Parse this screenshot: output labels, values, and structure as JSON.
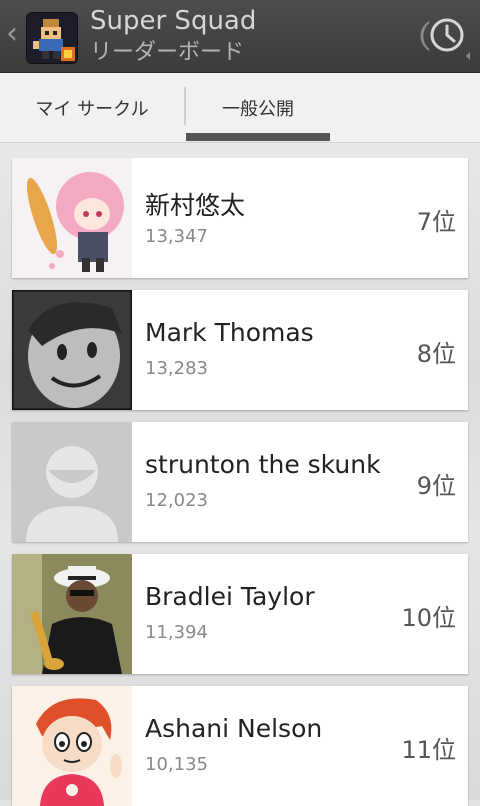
{
  "header": {
    "title": "Super Squad",
    "subtitle": "リーダーボード"
  },
  "icons": {
    "back": "chevron-left-icon",
    "history": "clock-history-icon"
  },
  "tabs": [
    {
      "label": "マイ サークル",
      "selected": false
    },
    {
      "label": "一般公開",
      "selected": true
    }
  ],
  "leaderboard": [
    {
      "name": "新村悠太",
      "score": "13,347",
      "rank": "7位"
    },
    {
      "name": "Mark Thomas",
      "score": "13,283",
      "rank": "8位"
    },
    {
      "name": "strunton the skunk",
      "score": "12,023",
      "rank": "9位"
    },
    {
      "name": "Bradlei Taylor",
      "score": "11,394",
      "rank": "10位"
    },
    {
      "name": "Ashani Nelson",
      "score": "10,135",
      "rank": "11位"
    }
  ],
  "colors": {
    "actionbar": "#444444",
    "tab_indicator": "#555555",
    "card": "#ffffff"
  }
}
